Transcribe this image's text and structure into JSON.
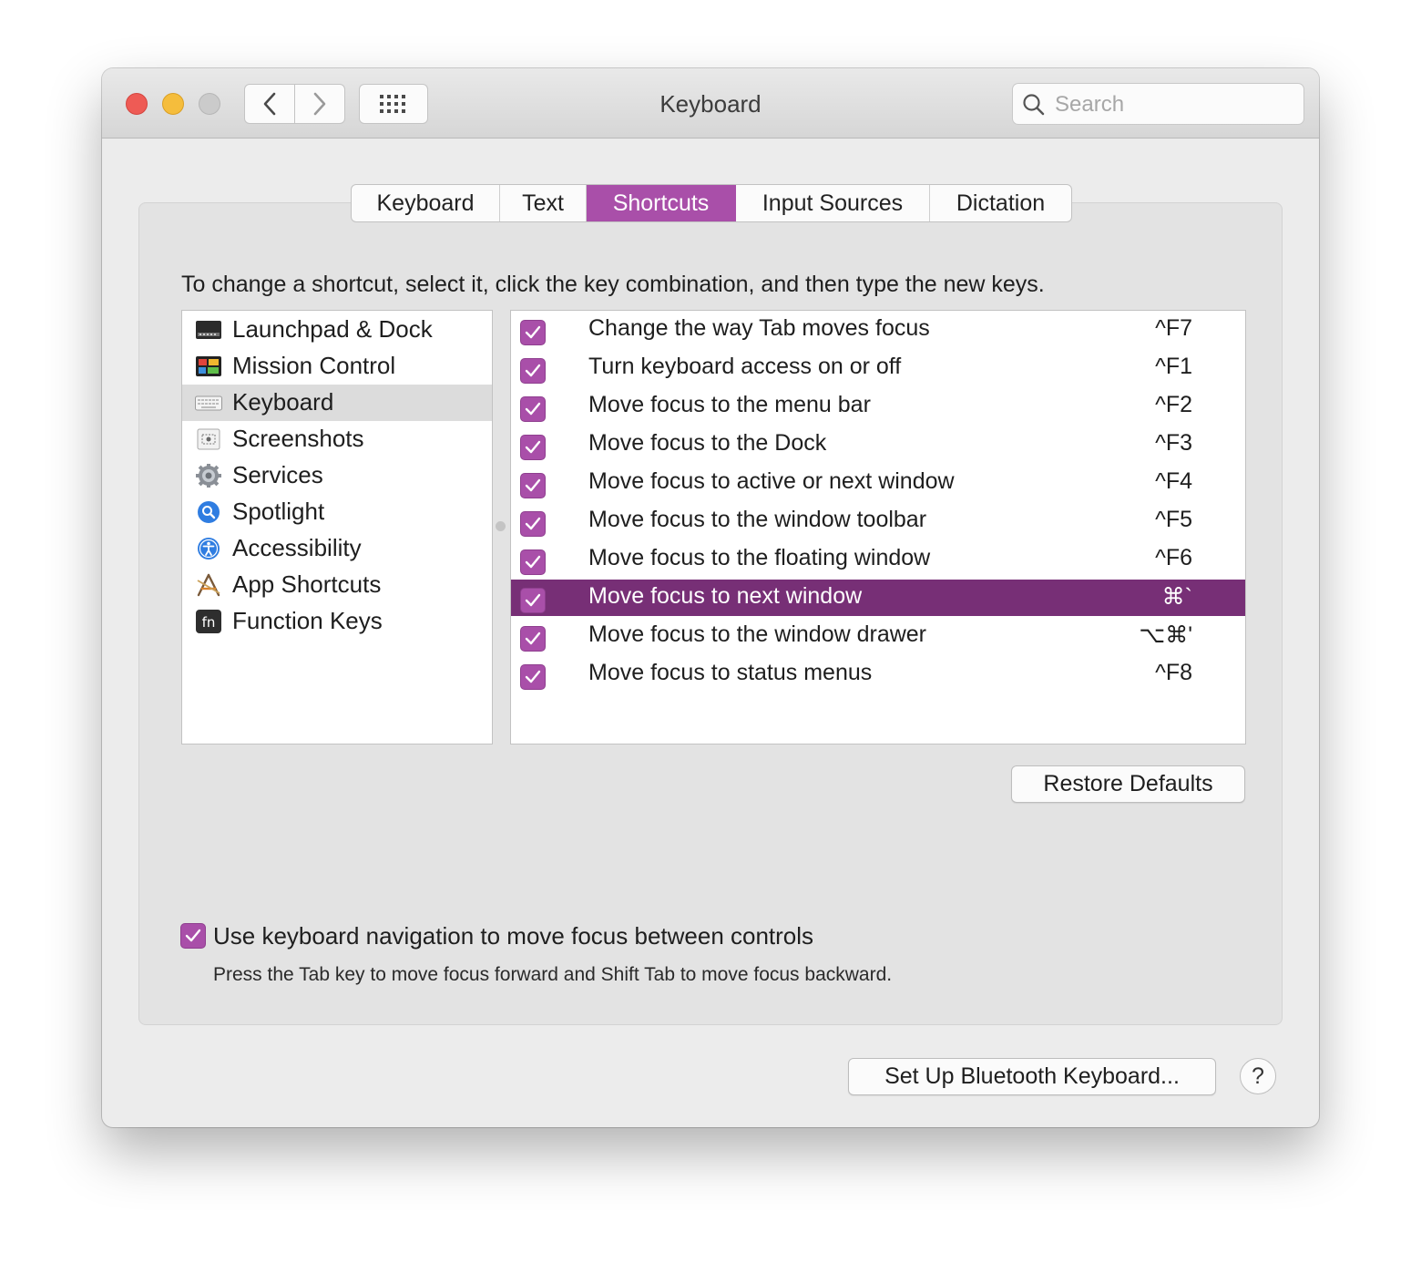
{
  "window": {
    "title": "Keyboard",
    "search_placeholder": "Search"
  },
  "tabs": [
    {
      "label": "Keyboard",
      "active": false
    },
    {
      "label": "Text",
      "active": false
    },
    {
      "label": "Shortcuts",
      "active": true
    },
    {
      "label": "Input Sources",
      "active": false
    },
    {
      "label": "Dictation",
      "active": false
    }
  ],
  "instruction": "To change a shortcut, select it, click the key combination, and then type the new keys.",
  "categories": [
    {
      "label": "Launchpad & Dock",
      "icon": "launchpad-dock-icon",
      "selected": false
    },
    {
      "label": "Mission Control",
      "icon": "mission-control-icon",
      "selected": false
    },
    {
      "label": "Keyboard",
      "icon": "keyboard-icon",
      "selected": true
    },
    {
      "label": "Screenshots",
      "icon": "screenshots-icon",
      "selected": false
    },
    {
      "label": "Services",
      "icon": "gear-icon",
      "selected": false
    },
    {
      "label": "Spotlight",
      "icon": "spotlight-icon",
      "selected": false
    },
    {
      "label": "Accessibility",
      "icon": "accessibility-icon",
      "selected": false
    },
    {
      "label": "App Shortcuts",
      "icon": "app-shortcuts-icon",
      "selected": false
    },
    {
      "label": "Function Keys",
      "icon": "fn-key-icon",
      "selected": false
    }
  ],
  "shortcuts": [
    {
      "checked": true,
      "name": "Change the way Tab moves focus",
      "keys": "^F7",
      "selected": false
    },
    {
      "checked": true,
      "name": "Turn keyboard access on or off",
      "keys": "^F1",
      "selected": false
    },
    {
      "checked": true,
      "name": "Move focus to the menu bar",
      "keys": "^F2",
      "selected": false
    },
    {
      "checked": true,
      "name": "Move focus to the Dock",
      "keys": "^F3",
      "selected": false
    },
    {
      "checked": true,
      "name": "Move focus to active or next window",
      "keys": "^F4",
      "selected": false
    },
    {
      "checked": true,
      "name": "Move focus to the window toolbar",
      "keys": "^F5",
      "selected": false
    },
    {
      "checked": true,
      "name": "Move focus to the floating window",
      "keys": "^F6",
      "selected": false
    },
    {
      "checked": true,
      "name": "Move focus to next window",
      "keys": "⌘`",
      "selected": true
    },
    {
      "checked": true,
      "name": "Move focus to the window drawer",
      "keys": "⌥⌘'",
      "selected": false
    },
    {
      "checked": true,
      "name": "Move focus to status menus",
      "keys": "^F8",
      "selected": false
    }
  ],
  "restore_button": "Restore Defaults",
  "keyboard_navigation": {
    "checked": true,
    "label": "Use keyboard navigation to move focus between controls",
    "hint": "Press the Tab key to move focus forward and Shift Tab to move focus backward."
  },
  "bluetooth_button": "Set Up Bluetooth Keyboard...",
  "help_button": "?",
  "colors": {
    "accent": "#a94fa9",
    "selection": "#772f76",
    "close": "#ee5b55",
    "minimize": "#f5bd3c",
    "zoom_disabled": "#cbcbcb"
  }
}
